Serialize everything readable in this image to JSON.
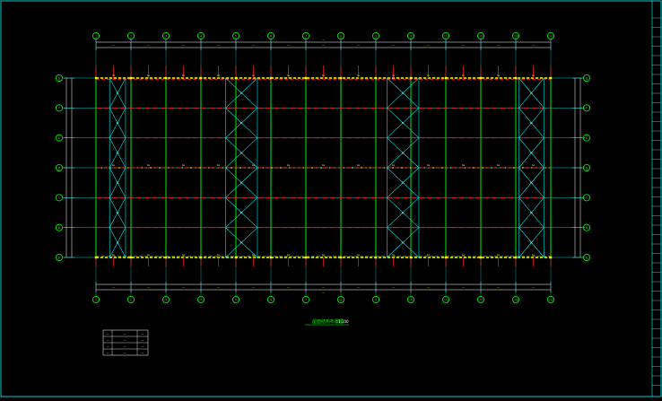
{
  "drawing": {
    "title": "屋面结构布置图",
    "scale": "1:100",
    "total_length_label": "—",
    "total_width_label": "—"
  },
  "grid": {
    "columns": [
      "1",
      "2",
      "3",
      "4",
      "5",
      "6",
      "7",
      "8",
      "9",
      "10",
      "11",
      "12",
      "13",
      "14"
    ],
    "rows": [
      "A",
      "B",
      "C",
      "D",
      "E",
      "F",
      "G"
    ],
    "bay_label": "—",
    "span_label": "—",
    "braced_bays": [
      [
        1,
        2
      ],
      [
        5,
        6
      ],
      [
        10,
        11
      ],
      [
        14,
        15
      ]
    ]
  },
  "legend": {
    "rows": [
      [
        "—",
        "—",
        "—"
      ],
      [
        "—",
        "—",
        "—"
      ],
      [
        "—",
        "—",
        "—"
      ],
      [
        "—",
        "—",
        "—"
      ]
    ]
  },
  "colors": {
    "frame": "#00ff00",
    "purlin": "#ff2020",
    "axis": "#00ffff",
    "brace": "#00e5e5",
    "dimension": "#ffff00",
    "text": "#ffffff",
    "border": "#00ffff"
  }
}
